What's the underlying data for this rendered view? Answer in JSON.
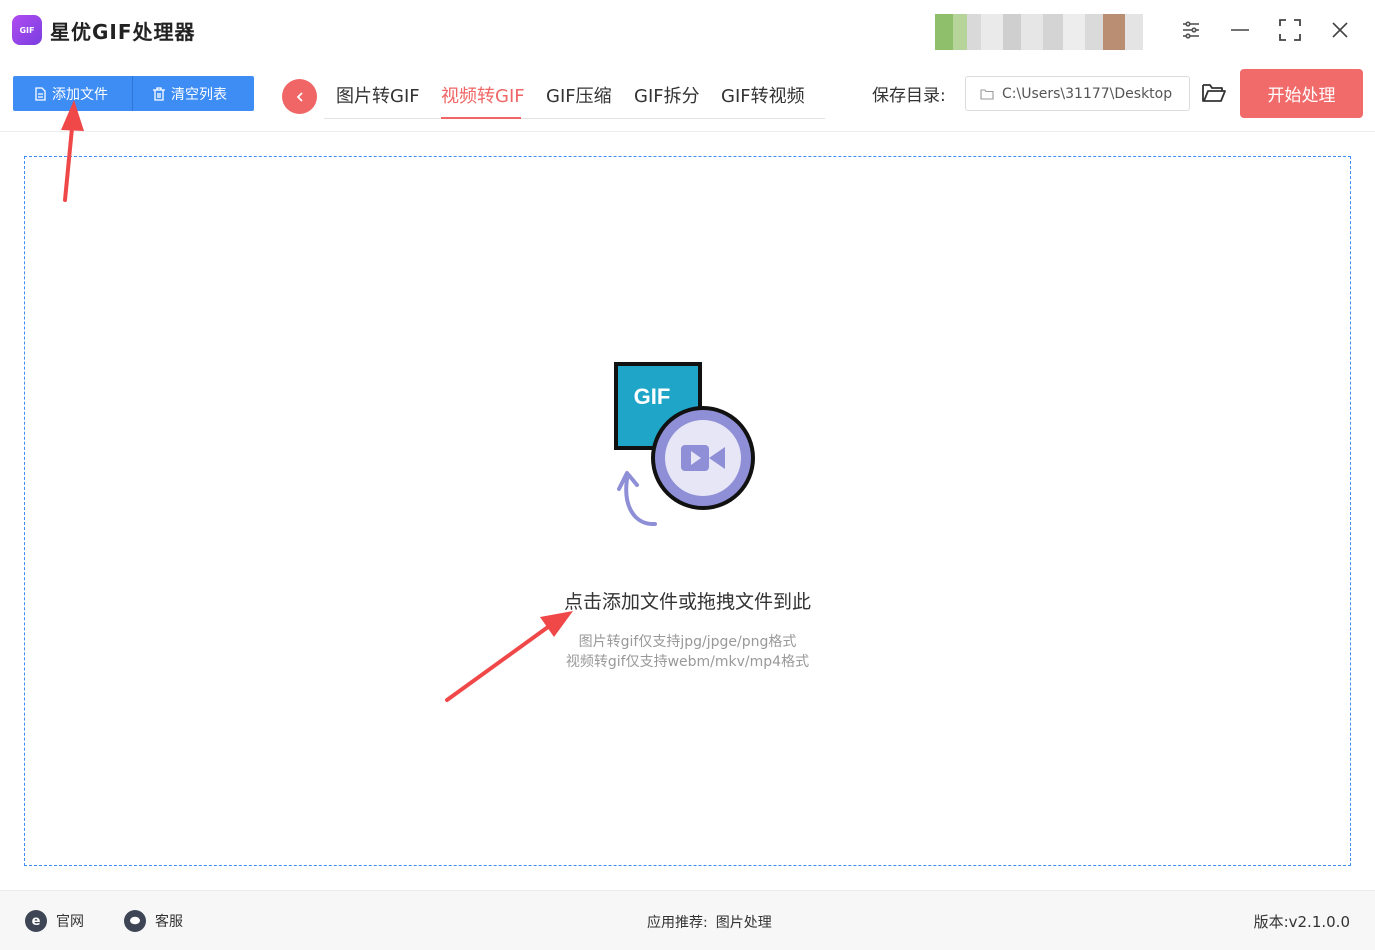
{
  "app": {
    "title": "星优GIF处理器",
    "logo_text": "GIF"
  },
  "window_controls": {
    "settings_icon": "sliders-icon",
    "minimize_icon": "minimize-icon",
    "maximize_icon": "maximize-icon",
    "close_icon": "close-icon"
  },
  "toolbar": {
    "add_file_label": "添加文件",
    "clear_list_label": "清空列表",
    "tabs": [
      {
        "label": "图片转GIF",
        "active": false
      },
      {
        "label": "视频转GIF",
        "active": true
      },
      {
        "label": "GIF压缩",
        "active": false
      },
      {
        "label": "GIF拆分",
        "active": false
      },
      {
        "label": "GIF转视频",
        "active": false
      }
    ],
    "save_label": "保存目录:",
    "save_path": "C:\\Users\\31177\\Desktop",
    "start_label": "开始处理"
  },
  "dropzone": {
    "illustration_text": "GIF",
    "main_text": "点击添加文件或拖拽文件到此",
    "hint_image": "图片转gif仅支持jpg/jpge/png格式",
    "hint_video": "视频转gif仅支持webm/mkv/mp4格式"
  },
  "footer": {
    "website_label": "官网",
    "service_label": "客服",
    "recommend_label": "应用推荐:",
    "recommend_link": "图片处理",
    "version_label": "版本:",
    "version_value": "v2.1.0.0"
  },
  "colors": {
    "accent_red": "#f06565",
    "primary_blue": "#3d8df5",
    "gif_teal": "#1fa5c8",
    "video_purple": "#8e8fd6"
  }
}
